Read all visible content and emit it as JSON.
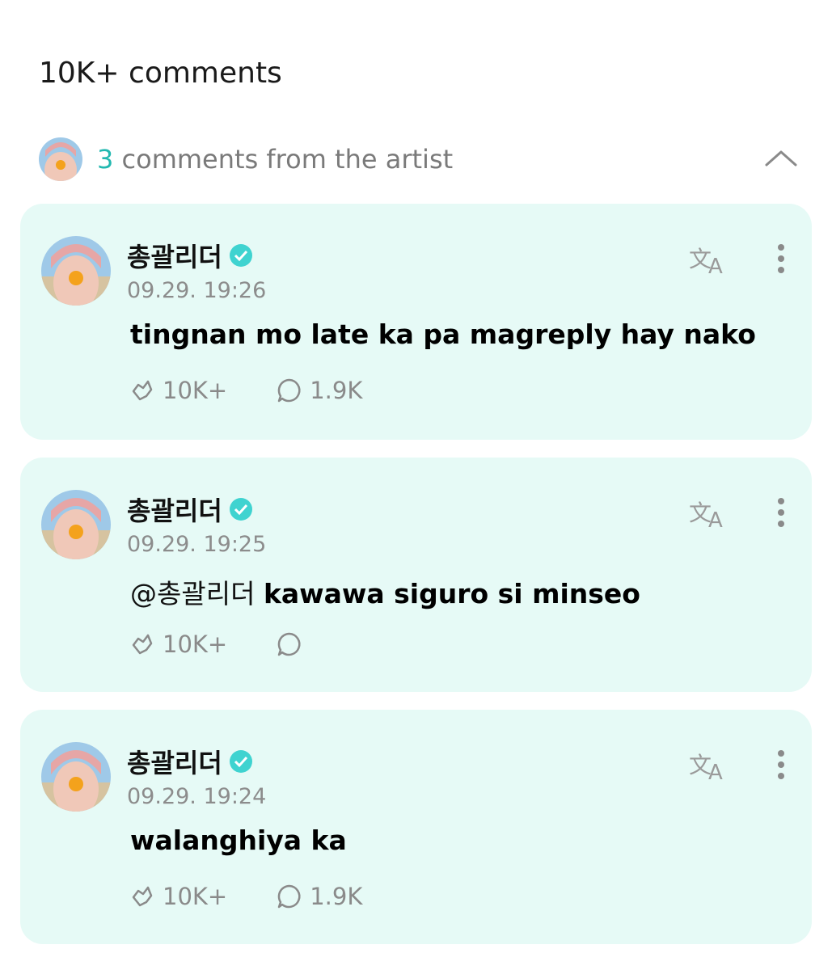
{
  "header": {
    "comment_count": "10K+ comments"
  },
  "artist_summary": {
    "count": "3",
    "text": " comments from the artist"
  },
  "comments": [
    {
      "author": "총괄리더",
      "time": "09.29. 19:26",
      "mention": "",
      "text": "tingnan mo late ka pa magreply hay nako",
      "likes": "10K+",
      "replies": "1.9K"
    },
    {
      "author": "총괄리더",
      "time": "09.29. 19:25",
      "mention": "@총괄리더 ",
      "text": "kawawa siguro si minseo",
      "likes": "10K+",
      "replies": ""
    },
    {
      "author": "총괄리더",
      "time": "09.29. 19:24",
      "mention": "",
      "text": "walanghiya ka",
      "likes": "10K+",
      "replies": "1.9K"
    }
  ],
  "colors": {
    "card_bg": "#e6faf6",
    "accent": "#22b8b0",
    "verified": "#3fd3d0",
    "meta": "#8a8a8a"
  },
  "icons": [
    "chevron-up-icon",
    "verified-badge-icon",
    "translate-icon",
    "more-vertical-icon",
    "like-icon",
    "reply-icon"
  ]
}
